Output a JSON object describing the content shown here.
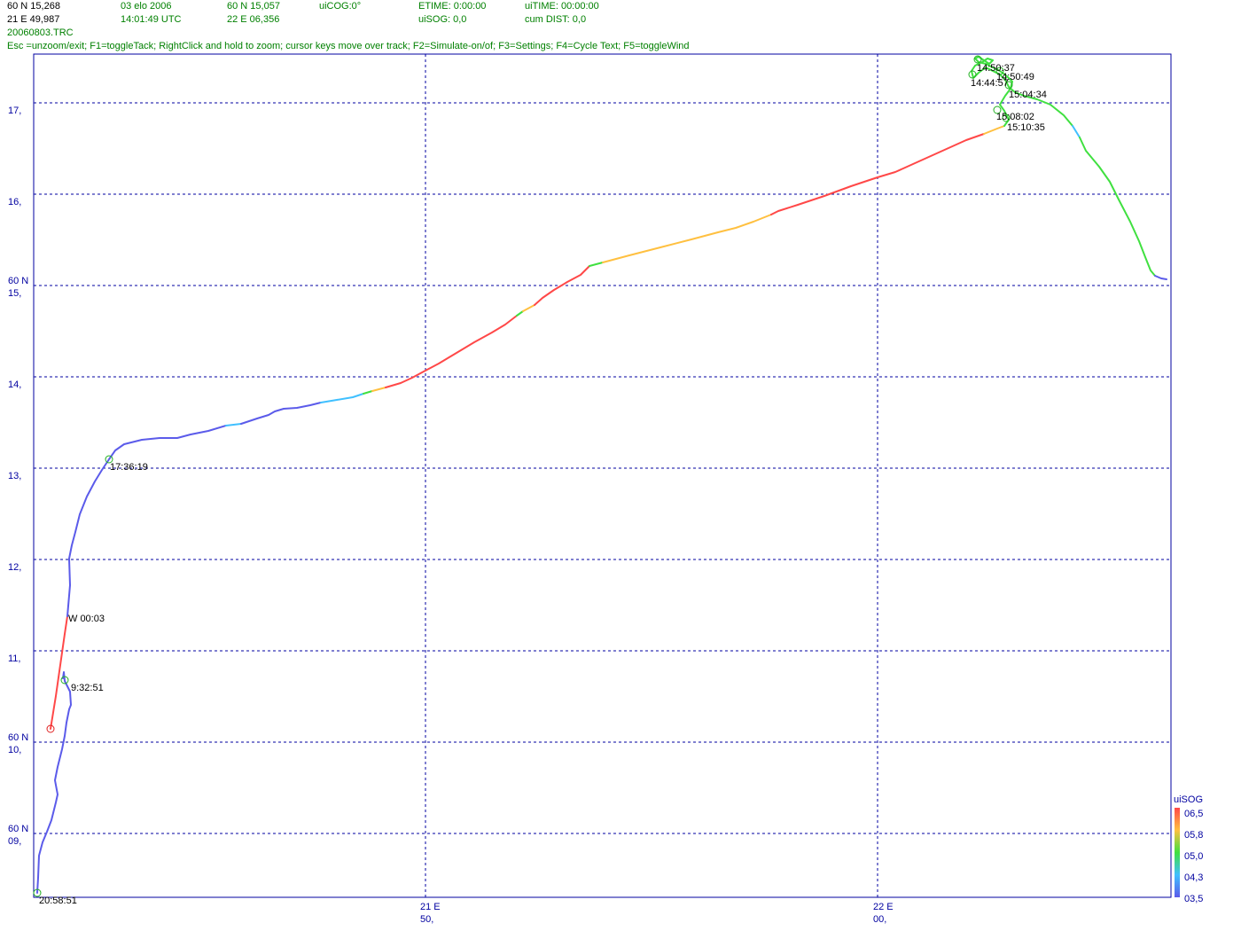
{
  "header": {
    "lat": "60 N 15,268",
    "lon": "21 E 49,987",
    "date": "03 elo 2006",
    "time": "14:01:49 UTC",
    "cursor_lat": "60 N 15,057",
    "cursor_lon": "22 E 06,356",
    "cog": "uiCOG:0°",
    "sog": "uiSOG: 0,0",
    "etime": "ETIME: 0:00:00",
    "uitime": "uiTIME: 00:00:00",
    "cumdist": "cum DIST: 0,0",
    "filename": "20060803.TRC",
    "help": "Esc =unzoom/exit; F1=toggleTack; RightClick and hold to zoom; cursor keys move over track; F2=Simulate-on/of; F3=Settings; F4=Cycle Text; F5=toggleWind"
  },
  "y_ticks": [
    {
      "line1": "17,",
      "line2": ""
    },
    {
      "line1": "16,",
      "line2": ""
    },
    {
      "line1": "60 N",
      "line2": "15,"
    },
    {
      "line1": "14,",
      "line2": ""
    },
    {
      "line1": "13,",
      "line2": ""
    },
    {
      "line1": "12,",
      "line2": ""
    },
    {
      "line1": "11,",
      "line2": ""
    },
    {
      "line1": "60 N",
      "line2": "10,"
    },
    {
      "line1": "60 N",
      "line2": "09,"
    }
  ],
  "x_ticks": [
    {
      "line1": "21 E",
      "line2": "50,"
    },
    {
      "line1": "22 E",
      "line2": "00,"
    }
  ],
  "track_labels": [
    "20:58:51",
    "9:32:51",
    "W 00:03",
    "17:36:19",
    "15:08:02",
    "15:10:35",
    "15:04:34",
    "14:50:49",
    "14:44:57",
    "14:50:37"
  ],
  "legend": {
    "title": "uiSOG",
    "values": [
      "06,5",
      "05,8",
      "05,0",
      "04,3",
      "03,5"
    ]
  },
  "colors": {
    "slow": "#5b5bea",
    "medium_low": "#40c0ff",
    "medium": "#40e040",
    "medium_high": "#ffc040",
    "fast": "#ff4848",
    "grid": "#0000a0",
    "marker_green": "#20b020",
    "marker_red": "#e02020"
  }
}
